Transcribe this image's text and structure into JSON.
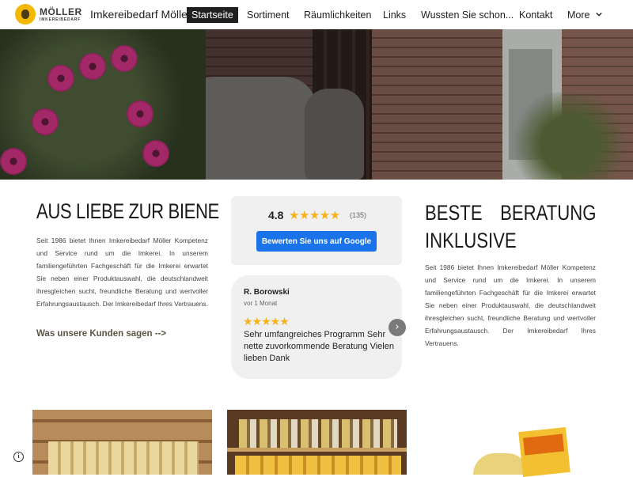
{
  "header": {
    "logo_name": "MÖLLER",
    "logo_sub": "IMKEREIBEDARF",
    "site_title": "Imkereibedarf Möller",
    "menu": [
      {
        "label": "Startseite"
      },
      {
        "label": "Sortiment"
      },
      {
        "label": "Räumlichkeiten"
      },
      {
        "label": "Links"
      },
      {
        "label": "Wussten Sie schon..."
      },
      {
        "label": "Kontakt"
      },
      {
        "label": "More"
      }
    ],
    "active_menu": "Startseite"
  },
  "left": {
    "heading": "AUS LIEBE ZUR BIENE",
    "paragraph": "Seit 1986 bietet Ihnen Imkereibedarf Möller Kompetenz und Service rund um die Imkerei. In unserem familiengeführten Fachgeschäft für die Imkerei erwartet Sie neben einer Produktauswahl, die deutschlandweit ihresgleichen sucht, freundliche Beratung und wertvoller Erfahrungsaustausch. Der Imkereibedarf Ihres Vertrauens.",
    "link": "Was unsere Kunden sagen -->"
  },
  "rating": {
    "score": "4.8",
    "stars": "★★★★★",
    "count": "(135)",
    "button": "Bewerten Sie uns auf Google"
  },
  "review": {
    "name": "R. Borowski",
    "time": "vor 1 Monat",
    "stars": "★★★★★",
    "text": "Sehr umfangreiches Programm Sehr nette zuvorkommende Beratung Vielen lieben Dank",
    "next": "›"
  },
  "right": {
    "heading_word1": "BESTE",
    "heading_word2": "BERATUNG",
    "heading_line2": "INKLUSIVE",
    "paragraph": "Seit 1986 bietet Ihnen Imkereibedarf Möller Kompetenz und Service rund um die Imkerei. In unserem familiengeführten Fachgeschäft für die Imkerei erwartet Sie neben einer Produktauswahl, die deutschlandweit ihresgleichen sucht, freundliche Beratung und wertvoller Erfahrungsaustausch. Der Imkereibedarf Ihres Vertrauens."
  },
  "footer": {
    "info_icon": "i"
  },
  "colors": {
    "accent_button": "#1a73e8",
    "star": "#f6b21b",
    "active_menu_bg": "#202020"
  }
}
